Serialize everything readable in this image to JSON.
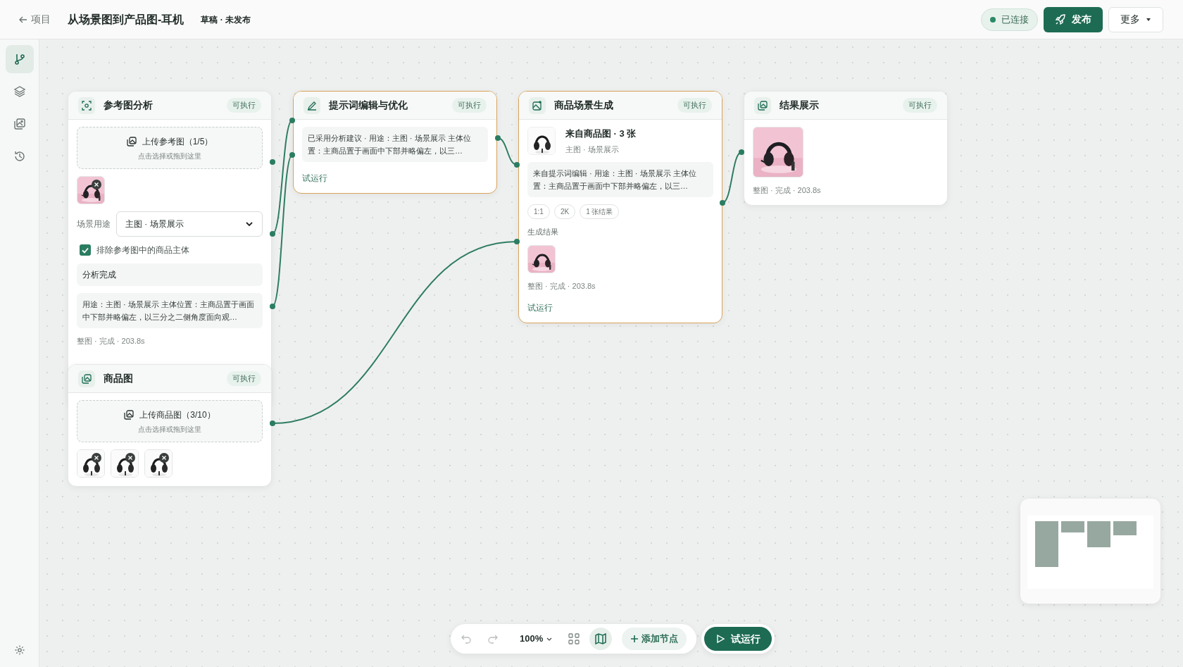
{
  "header": {
    "back": "项目",
    "title": "从场景图到产品图-耳机",
    "state": "草稿 · 未发布",
    "connection": "已连接",
    "publish": "发布",
    "more": "更多"
  },
  "sidebar": {
    "items": [
      {
        "kind": "flow",
        "selected": true
      },
      {
        "kind": "layers",
        "selected": false
      },
      {
        "kind": "gallery",
        "selected": false
      },
      {
        "kind": "history",
        "selected": false
      }
    ]
  },
  "nodes": [
    {
      "kind": "analyze",
      "title": "参考图分析",
      "badge": "可执行",
      "selected": false,
      "blocks": [
        {
          "kind": "upload",
          "label": "上传参考图（1/5）",
          "hint": "点击选择或拖到这里"
        },
        {
          "kind": "thumbs",
          "items": [
            {
              "kind": "picture",
              "removable": true
            }
          ]
        },
        {
          "kind": "select",
          "label": "场景用途",
          "value": "主图 · 场景展示"
        },
        {
          "kind": "checkbox",
          "label": "排除参考图中的商品主体",
          "checked": true
        },
        {
          "kind": "status",
          "text": "分析完成"
        },
        {
          "kind": "text",
          "text": "用途：主图 · 场景展示 主体位置：主商品置于画面中下部并略偏左，以三分之二侧角度面向观…"
        },
        {
          "kind": "meta",
          "text": "整图 · 完成 · 203.8s"
        }
      ]
    },
    {
      "kind": "edit",
      "title": "提示词编辑与优化",
      "badge": "可执行",
      "selected": true,
      "blocks": [
        {
          "kind": "text",
          "text": "已采用分析建议 · 用途：主图 · 场景展示 主体位置：主商品置于画面中下部并略偏左，以三…"
        },
        {
          "kind": "link",
          "text": "试运行"
        }
      ]
    },
    {
      "kind": "generate",
      "title": "商品场景生成",
      "badge": "可执行",
      "selected": true,
      "blocks": [
        {
          "kind": "source",
          "title": "来自商品图 · 3 张",
          "subtitle": "主图 · 场景展示"
        },
        {
          "kind": "text",
          "text": "来自提示词编辑 · 用途：主图 · 场景展示 主体位置：主商品置于画面中下部并略偏左，以三…"
        },
        {
          "kind": "chips",
          "items": [
            "1:1",
            "2K",
            "1 张结果"
          ]
        },
        {
          "kind": "label",
          "text": "生成结果"
        },
        {
          "kind": "thumbs",
          "items": [
            {
              "kind": "picture",
              "removable": false
            }
          ]
        },
        {
          "kind": "meta",
          "text": "整图 · 完成 · 203.8s"
        },
        {
          "kind": "link",
          "text": "试运行"
        }
      ]
    },
    {
      "kind": "result",
      "title": "结果展示",
      "badge": "可执行",
      "selected": false,
      "blocks": [
        {
          "kind": "thumbs",
          "items": [
            {
              "kind": "picture",
              "removable": false
            }
          ]
        },
        {
          "kind": "meta",
          "text": "整图 · 完成 · 203.8s"
        }
      ]
    },
    {
      "kind": "product",
      "title": "商品图",
      "badge": "可执行",
      "selected": false,
      "blocks": [
        {
          "kind": "upload",
          "label": "上传商品图（3/10）",
          "hint": "点击选择或拖到这里"
        },
        {
          "kind": "thumbs",
          "items": [
            {
              "kind": "product",
              "removable": true
            },
            {
              "kind": "product",
              "removable": true
            },
            {
              "kind": "product",
              "removable": true
            }
          ]
        }
      ]
    }
  ],
  "toolbar": {
    "zoom": "100%",
    "minimap_on": true,
    "add_node": "添加节点",
    "run": "试运行"
  }
}
